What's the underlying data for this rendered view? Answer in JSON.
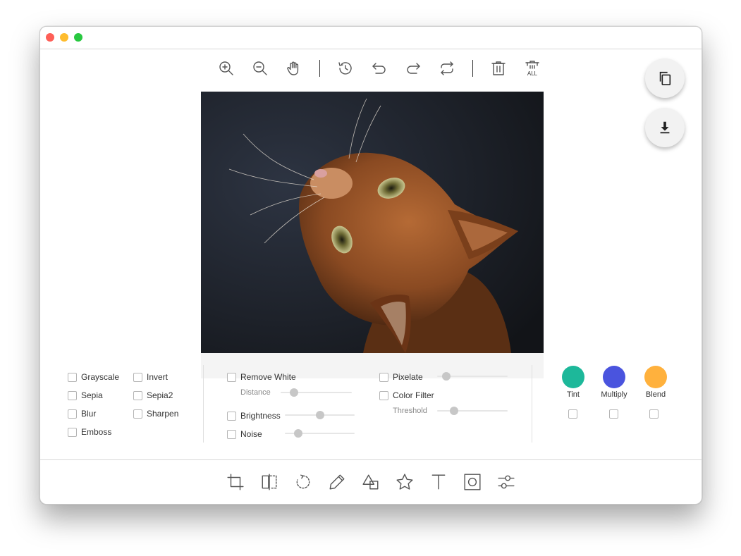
{
  "window": {
    "controls": [
      "close",
      "minimize",
      "zoom"
    ]
  },
  "top_toolbar": [
    {
      "name": "zoom-in-icon"
    },
    {
      "name": "zoom-out-icon"
    },
    {
      "name": "pan-hand-icon"
    },
    {
      "name": "history-icon"
    },
    {
      "name": "undo-icon"
    },
    {
      "name": "redo-icon"
    },
    {
      "name": "reset-icon"
    },
    {
      "name": "delete-icon"
    },
    {
      "name": "delete-all-icon",
      "label": "ALL"
    }
  ],
  "actions": {
    "copy": "copy-icon",
    "download": "download-icon"
  },
  "filters": {
    "basic": {
      "grayscale": "Grayscale",
      "invert": "Invert",
      "sepia": "Sepia",
      "sepia2": "Sepia2",
      "blur": "Blur",
      "sharpen": "Sharpen",
      "emboss": "Emboss"
    },
    "adjust": {
      "remove_white": "Remove White",
      "distance": "Distance",
      "distance_value": 0.15,
      "brightness": "Brightness",
      "brightness_value": 0.5,
      "noise": "Noise",
      "noise_value": 0.15
    },
    "effects": {
      "pixelate": "Pixelate",
      "pixelate_value": 0.08,
      "color_filter": "Color Filter",
      "threshold": "Threshold",
      "threshold_value": 0.2
    },
    "color_modes": [
      {
        "label": "Tint",
        "color": "#1db89a"
      },
      {
        "label": "Multiply",
        "color": "#4a54de"
      },
      {
        "label": "Blend",
        "color": "#ffb13d"
      }
    ]
  },
  "bottom_toolbar": [
    "crop-icon",
    "flip-icon",
    "rotate-icon",
    "draw-icon",
    "shape-icon",
    "icon-tool-icon",
    "text-icon",
    "mask-icon",
    "filter-icon"
  ]
}
